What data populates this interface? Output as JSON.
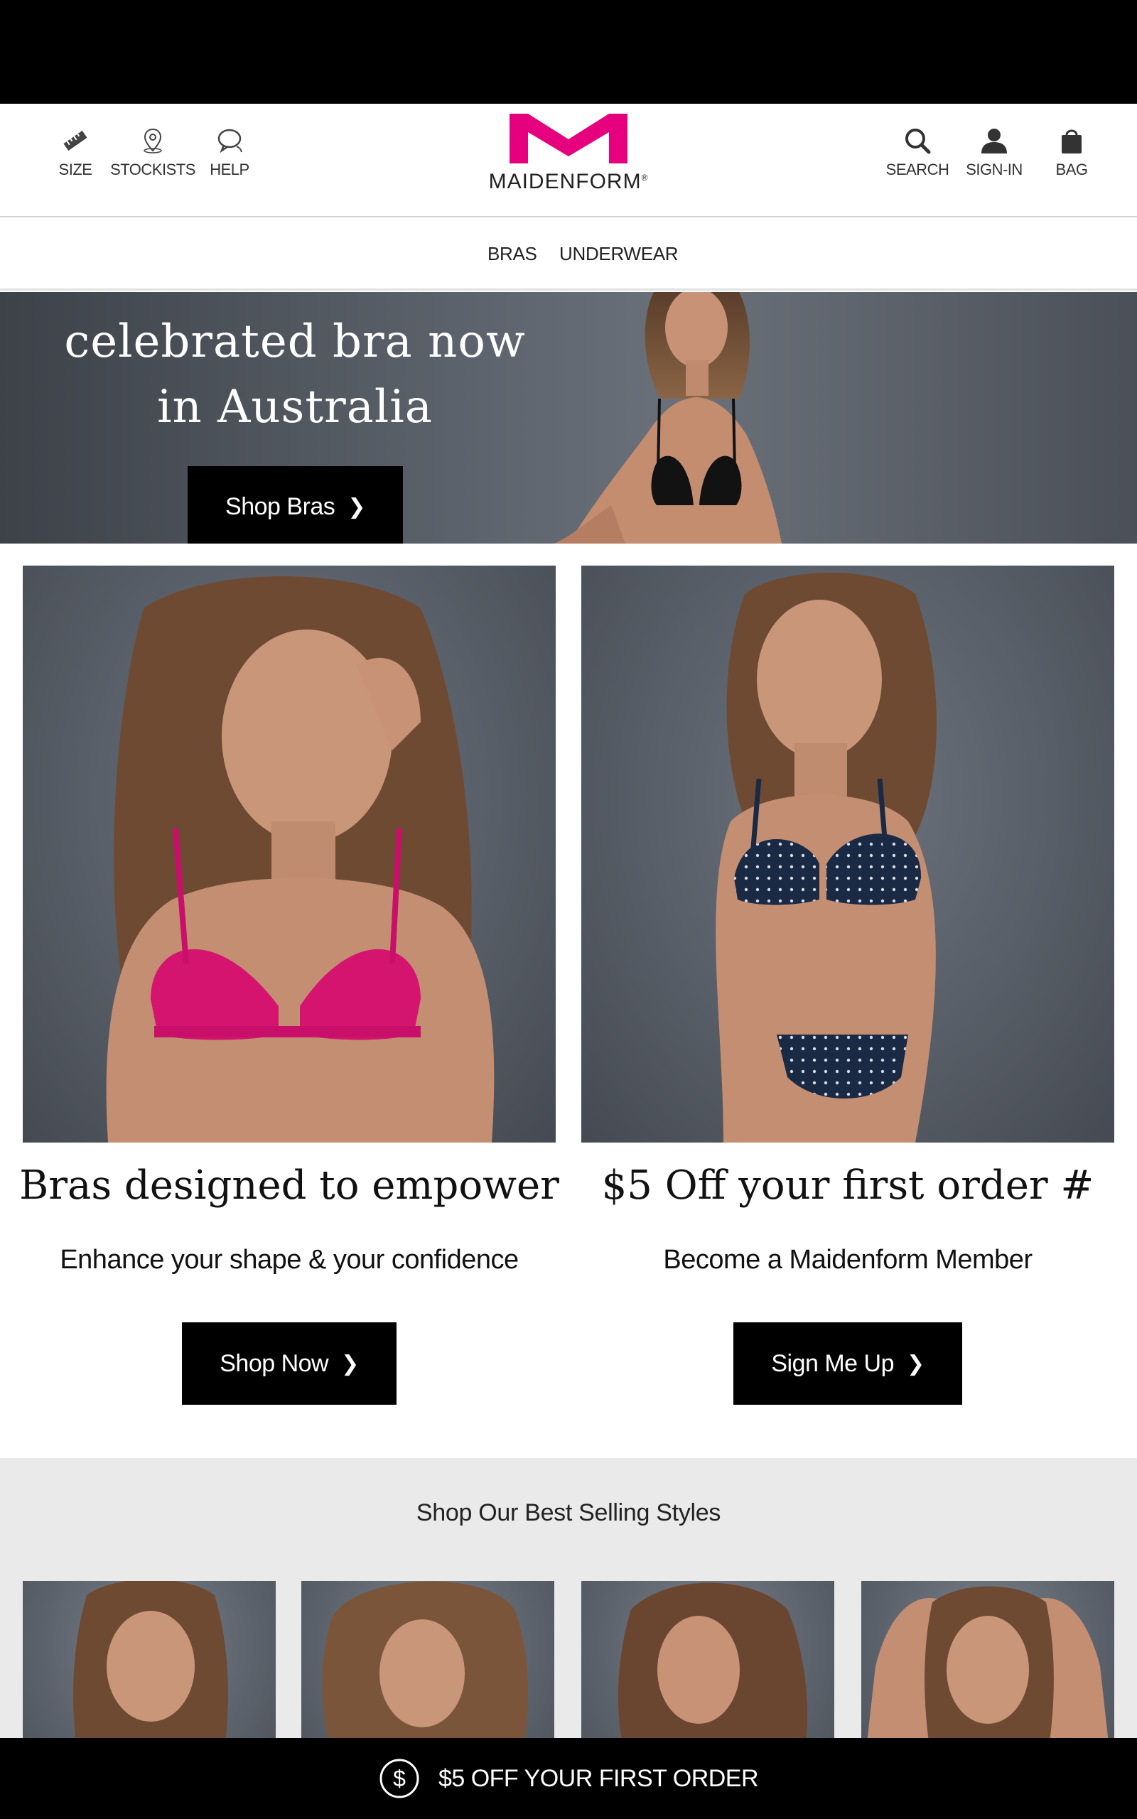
{
  "header": {
    "utilities_left": [
      {
        "label": "SIZE",
        "icon": "ruler-icon"
      },
      {
        "label": "STOCKISTS",
        "icon": "location-pin-icon"
      },
      {
        "label": "HELP",
        "icon": "chat-bubbles-icon"
      }
    ],
    "utilities_right": [
      {
        "label": "SEARCH",
        "icon": "search-icon"
      },
      {
        "label": "SIGN-IN",
        "icon": "user-icon"
      },
      {
        "label": "BAG",
        "icon": "shopping-bag-icon"
      }
    ],
    "logo_text": "MAIDENFORM",
    "logo_mark": "®"
  },
  "nav": {
    "items": [
      "BRAS",
      "UNDERWEAR"
    ]
  },
  "hero": {
    "line1": "celebrated bra now",
    "line2": "in Australia",
    "button": "Shop Bras"
  },
  "tiles": [
    {
      "title": "Bras designed to empower",
      "subtitle": "Enhance your shape & your confidence",
      "button": "Shop Now"
    },
    {
      "title": "$5 Off your first order #",
      "subtitle": "Become a Maidenform Member",
      "button": "Sign Me Up"
    }
  ],
  "best_sellers": {
    "title": "Shop Our Best Selling Styles"
  },
  "promo_bar": {
    "icon": "dollar-circle-icon",
    "text": "$5 OFF YOUR FIRST ORDER"
  },
  "colors": {
    "brand_magenta": "#e6007e",
    "black": "#000000",
    "hero_bg": "#5c626b",
    "section_gray": "#eaeaea"
  }
}
